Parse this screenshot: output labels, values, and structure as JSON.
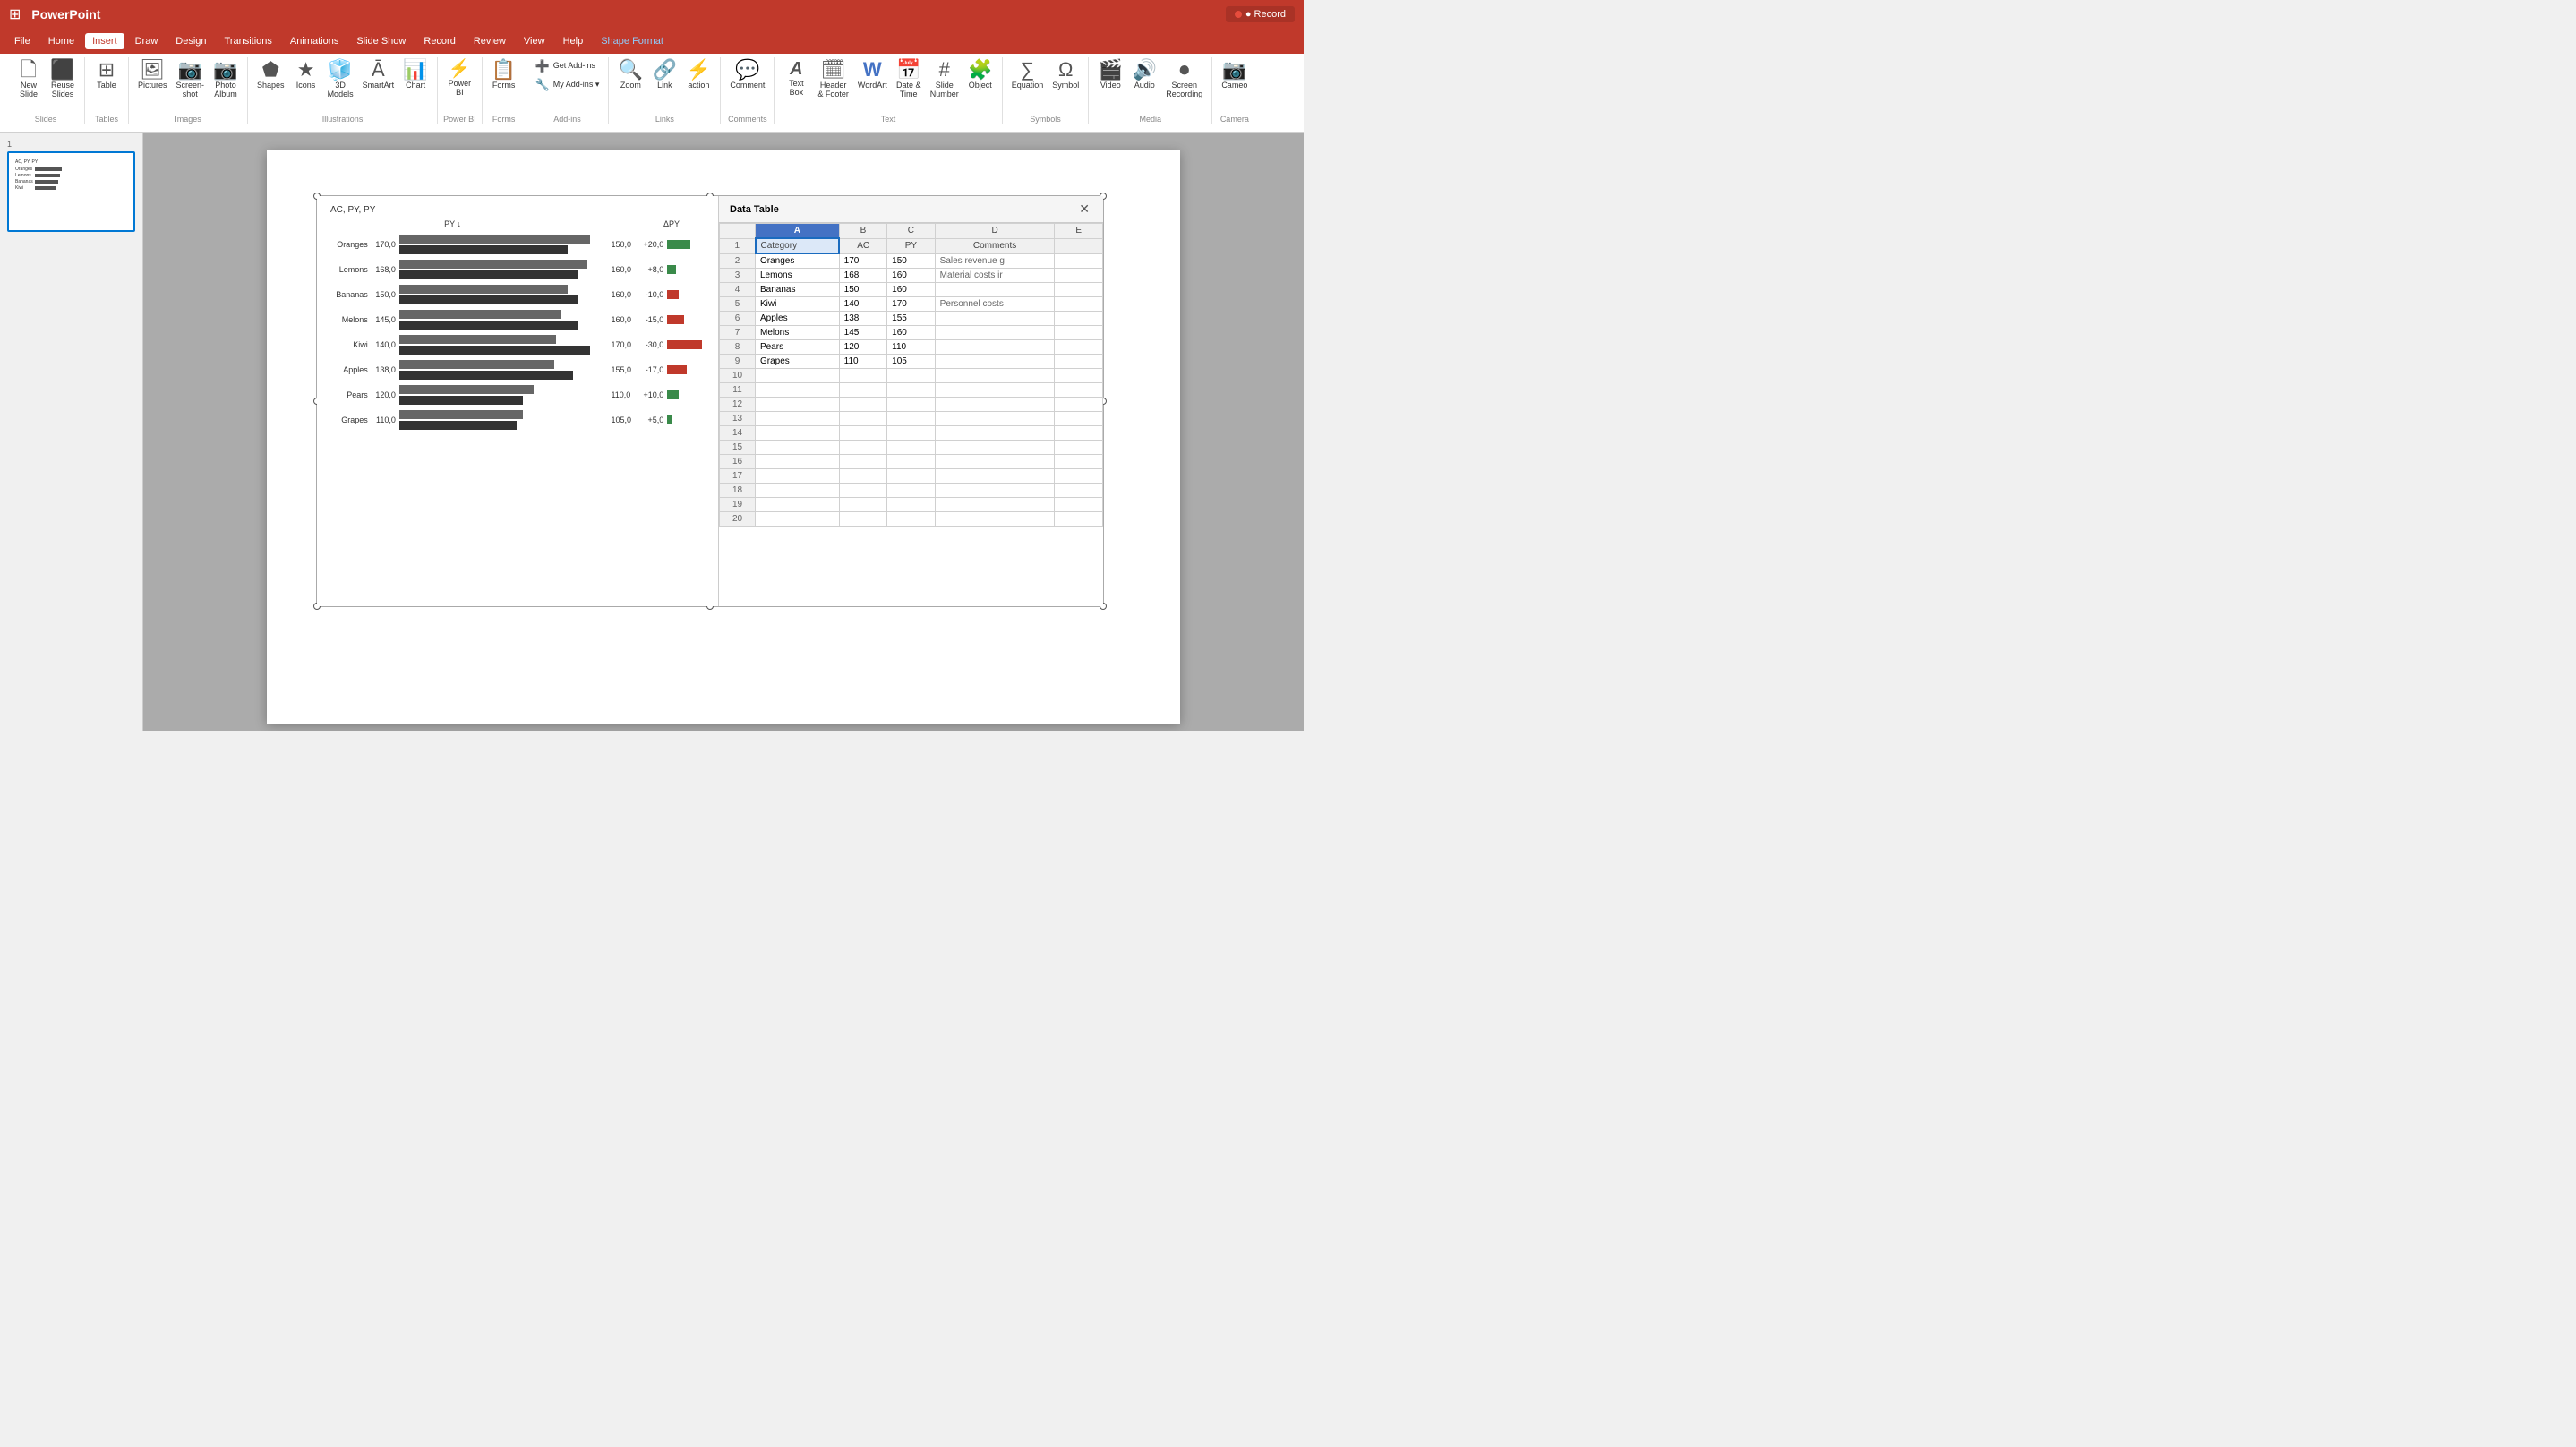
{
  "app": {
    "name": "PowerPoint",
    "waffle": "⊞"
  },
  "titlebar": {
    "record_label": "● Record"
  },
  "menu": {
    "items": [
      "File",
      "Home",
      "Insert",
      "Draw",
      "Design",
      "Transitions",
      "Animations",
      "Slide Show",
      "Record",
      "Review",
      "View",
      "Help",
      "Shape Format"
    ]
  },
  "ribbon": {
    "groups": [
      {
        "label": "Slides",
        "buttons": [
          {
            "icon": "🗋",
            "label": "New\nSlide"
          },
          {
            "icon": "⬛",
            "label": "Reuse\nSlides"
          }
        ]
      },
      {
        "label": "Tables",
        "buttons": [
          {
            "icon": "⊞",
            "label": "Table"
          }
        ]
      },
      {
        "label": "Images",
        "buttons": [
          {
            "icon": "🖼",
            "label": "Pictures"
          },
          {
            "icon": "📷",
            "label": "Screenshot"
          },
          {
            "icon": "📷",
            "label": "Photo\nAlbum"
          }
        ]
      },
      {
        "label": "Illustrations",
        "buttons": [
          {
            "icon": "⬟",
            "label": "Shapes"
          },
          {
            "icon": "★",
            "label": "Icons"
          },
          {
            "icon": "🧊",
            "label": "3D\nModels"
          },
          {
            "icon": "Ā",
            "label": "SmartArt"
          },
          {
            "icon": "📊",
            "label": "Chart"
          }
        ]
      },
      {
        "label": "Power BI",
        "buttons": [
          {
            "icon": "⚡",
            "label": "Power\nBI"
          }
        ]
      },
      {
        "label": "Forms",
        "buttons": [
          {
            "icon": "📋",
            "label": "Forms"
          }
        ]
      },
      {
        "label": "Add-ins",
        "buttons": [
          {
            "icon": "➕",
            "label": "Get Add-ins"
          },
          {
            "icon": "🔧",
            "label": "My Add-ins"
          }
        ]
      },
      {
        "label": "Links",
        "buttons": [
          {
            "icon": "🔍",
            "label": "Zoom"
          },
          {
            "icon": "🔗",
            "label": "Link"
          },
          {
            "icon": "⚡",
            "label": "action"
          }
        ]
      },
      {
        "label": "Comments",
        "buttons": [
          {
            "icon": "💬",
            "label": "Comment"
          }
        ]
      },
      {
        "label": "Text",
        "buttons": [
          {
            "icon": "𝐀",
            "label": "Text\nBox"
          },
          {
            "icon": "🗓",
            "label": "Header\n& Footer"
          },
          {
            "icon": "W",
            "label": "WordArt"
          },
          {
            "icon": "📅",
            "label": "Date &\nTime"
          },
          {
            "icon": "#",
            "label": "Slide\nNumber"
          },
          {
            "icon": "🧩",
            "label": "Object"
          }
        ]
      },
      {
        "label": "Symbols",
        "buttons": [
          {
            "icon": "∑",
            "label": "Equation"
          },
          {
            "icon": "Ω",
            "label": "Symbol"
          }
        ]
      },
      {
        "label": "Media",
        "buttons": [
          {
            "icon": "🎬",
            "label": "Video"
          },
          {
            "icon": "🔊",
            "label": "Audio"
          },
          {
            "icon": "⏺",
            "label": "Screen\nRecording"
          }
        ]
      },
      {
        "label": "Camera",
        "buttons": [
          {
            "icon": "📷",
            "label": "Cameo"
          }
        ]
      }
    ]
  },
  "slide": {
    "num": "1",
    "chart": {
      "title": "AC, PY, PY",
      "header_py": "PY ↓",
      "header_delta": "ΔPY",
      "rows": [
        {
          "label": "Oranges",
          "py": 170,
          "ac": 150,
          "delta": "+20,0",
          "delta_val": 20
        },
        {
          "label": "Lemons",
          "py": 168,
          "ac": 160,
          "delta": "+8,0",
          "delta_val": 8
        },
        {
          "label": "Bananas",
          "py": 150,
          "ac": 160,
          "delta": "-10,0",
          "delta_val": -10
        },
        {
          "label": "Melons",
          "py": 145,
          "ac": 160,
          "delta": "-15,0",
          "delta_val": -15
        },
        {
          "label": "Kiwi",
          "py": 140,
          "ac": 170,
          "delta": "-30,0",
          "delta_val": -30
        },
        {
          "label": "Apples",
          "py": 138,
          "ac": 155,
          "delta": "-17,0",
          "delta_val": -17
        },
        {
          "label": "Pears",
          "py": 120,
          "ac": 110,
          "delta": "+10,0",
          "delta_val": 10
        },
        {
          "label": "Grapes",
          "py": 110,
          "ac": 105,
          "delta": "+5,0",
          "delta_val": 5
        }
      ]
    },
    "data_table": {
      "title": "Data Table",
      "columns": [
        "",
        "A",
        "B",
        "C",
        "D",
        "E"
      ],
      "col_labels": [
        "",
        "Category",
        "AC",
        "PY",
        "Comments",
        ""
      ],
      "rows": [
        {
          "num": 2,
          "a": "Oranges",
          "b": "170",
          "c": "150",
          "d": "Sales revenue g",
          "e": ""
        },
        {
          "num": 3,
          "a": "Lemons",
          "b": "168",
          "c": "160",
          "d": "Material costs ir",
          "e": ""
        },
        {
          "num": 4,
          "a": "Bananas",
          "b": "150",
          "c": "160",
          "d": "",
          "e": ""
        },
        {
          "num": 5,
          "a": "Kiwi",
          "b": "140",
          "c": "170",
          "d": "Personnel costs",
          "e": ""
        },
        {
          "num": 6,
          "a": "Apples",
          "b": "138",
          "c": "155",
          "d": "",
          "e": ""
        },
        {
          "num": 7,
          "a": "Melons",
          "b": "145",
          "c": "160",
          "d": "",
          "e": ""
        },
        {
          "num": 8,
          "a": "Pears",
          "b": "120",
          "c": "110",
          "d": "",
          "e": ""
        },
        {
          "num": 9,
          "a": "Grapes",
          "b": "110",
          "c": "105",
          "d": "",
          "e": ""
        },
        {
          "num": 10,
          "a": "",
          "b": "",
          "c": "",
          "d": "",
          "e": ""
        },
        {
          "num": 11,
          "a": "",
          "b": "",
          "c": "",
          "d": "",
          "e": ""
        },
        {
          "num": 12,
          "a": "",
          "b": "",
          "c": "",
          "d": "",
          "e": ""
        },
        {
          "num": 13,
          "a": "",
          "b": "",
          "c": "",
          "d": "",
          "e": ""
        },
        {
          "num": 14,
          "a": "",
          "b": "",
          "c": "",
          "d": "",
          "e": ""
        },
        {
          "num": 15,
          "a": "",
          "b": "",
          "c": "",
          "d": "",
          "e": ""
        },
        {
          "num": 16,
          "a": "",
          "b": "",
          "c": "",
          "d": "",
          "e": ""
        },
        {
          "num": 17,
          "a": "",
          "b": "",
          "c": "",
          "d": "",
          "e": ""
        },
        {
          "num": 18,
          "a": "",
          "b": "",
          "c": "",
          "d": "",
          "e": ""
        },
        {
          "num": 19,
          "a": "",
          "b": "",
          "c": "",
          "d": "",
          "e": ""
        },
        {
          "num": 20,
          "a": "",
          "b": "",
          "c": "",
          "d": "",
          "e": ""
        }
      ]
    }
  }
}
